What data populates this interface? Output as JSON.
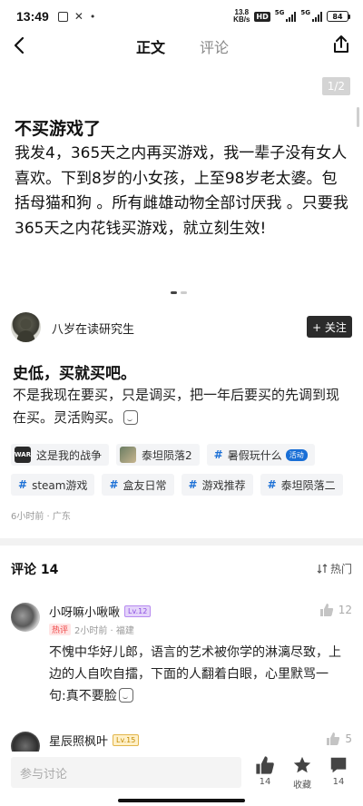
{
  "status_bar": {
    "time": "13:49",
    "net_speed_value": "13.8",
    "net_speed_unit": "KB/s",
    "hd": "HD",
    "net1": "5G",
    "net2": "5G",
    "battery": "84"
  },
  "nav": {
    "tab_body": "正文",
    "tab_comments": "评论"
  },
  "image_post": {
    "page_indicator": "1/2",
    "title": "不买游戏了",
    "body": "我发4，365天之内再买游戏，我一辈子没有女人喜欢。下到8岁的小女孩，上至98岁老太婆。包括母猫和狗 。所有雌雄动物全部讨厌我 。只要我365天之内花钱买游戏，就立刻生效!"
  },
  "author": {
    "name": "八岁在读研究生",
    "follow_label": "+ 关注"
  },
  "post": {
    "title": "史低，买就买吧。",
    "body": "不是我现在要买，只是调买，把一年后要买的先调到现在买。灵活购买。"
  },
  "tags": {
    "row1": [
      {
        "label": "这是我的战争",
        "thumb": "WAR"
      },
      {
        "label": "泰坦陨落2",
        "thumb": ""
      },
      {
        "label": "暑假玩什么",
        "badge": "活动"
      }
    ],
    "row2": [
      {
        "label": "steam游戏"
      },
      {
        "label": "盒友日常"
      },
      {
        "label": "游戏推荐"
      },
      {
        "label": "泰坦陨落二"
      }
    ]
  },
  "post_meta": "6小时前 · 广东",
  "comments_section": {
    "title": "评论 14",
    "sort_label": "热门"
  },
  "comments": [
    {
      "user": "小呀嘛小啾啾",
      "level": "Lv.12",
      "hot_tag": "热评",
      "meta": "2小时前 · 福建",
      "text": "不愧中华好儿郎，语言的艺术被你学的淋漓尽致，上边的人自吹自擂，下面的人翻着白眼，心里默骂一句:真不要脸",
      "likes": "12"
    },
    {
      "user": "星辰照枫叶",
      "level": "Lv.15",
      "likes": "5"
    }
  ],
  "bottom_bar": {
    "input_placeholder": "参与讨论",
    "like_count": "14",
    "favorite_label": "收藏",
    "comment_count": "14"
  },
  "colors": {
    "accent_blue": "#1a6fd6",
    "follow_bg": "#2b2b2b",
    "hot_red": "#e44444"
  }
}
